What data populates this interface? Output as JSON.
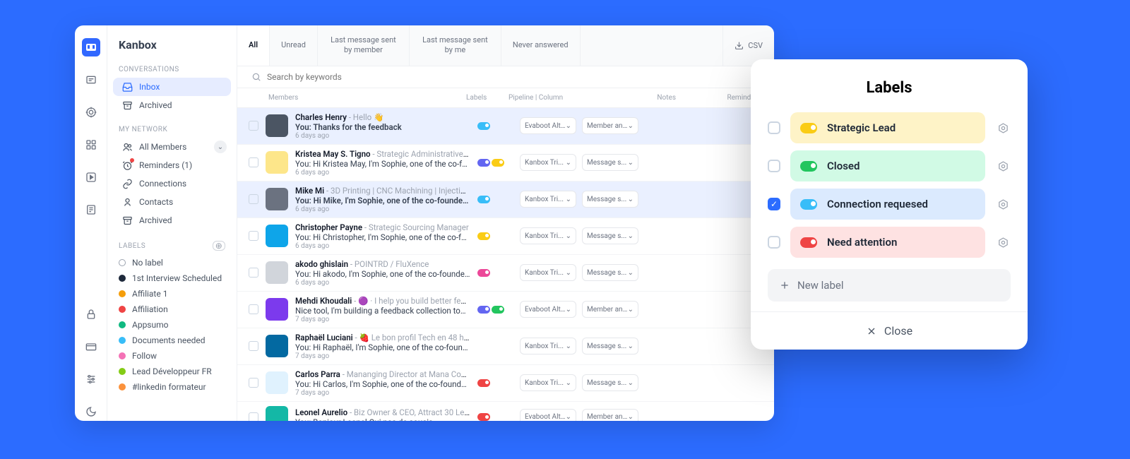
{
  "brand": "Kanbox",
  "iconRail": [
    "logo",
    "message",
    "target",
    "grid",
    "play",
    "file",
    "spacer",
    "lock",
    "card",
    "sliders",
    "moon"
  ],
  "sidebar": {
    "sections": {
      "conversations": {
        "title": "CONVERSATIONS",
        "items": [
          {
            "icon": "inbox",
            "label": "Inbox",
            "active": true
          },
          {
            "icon": "archive",
            "label": "Archived"
          }
        ]
      },
      "network": {
        "title": "MY NETWORK",
        "items": [
          {
            "icon": "users",
            "label": "All Members",
            "hasChevron": true
          },
          {
            "icon": "alarm",
            "label": "Reminders (1)",
            "badge": true
          },
          {
            "icon": "link",
            "label": "Connections"
          },
          {
            "icon": "contact",
            "label": "Contacts"
          },
          {
            "icon": "archive",
            "label": "Archived"
          }
        ]
      },
      "labels": {
        "title": "LABELS",
        "items": [
          {
            "color": "outline",
            "label": "No label"
          },
          {
            "color": "#1e293b",
            "label": "1st Interview Scheduled"
          },
          {
            "color": "#f59e0b",
            "label": "Affiliate 1"
          },
          {
            "color": "#ef4444",
            "label": "Affiliation"
          },
          {
            "color": "#10b981",
            "label": "Appsumo"
          },
          {
            "color": "#38bdf8",
            "label": "Documents needed"
          },
          {
            "color": "#f472b6",
            "label": "Follow"
          },
          {
            "color": "#84cc16",
            "label": "Lead Développeur FR"
          },
          {
            "color": "#fb923c",
            "label": "#linkedin formateur"
          }
        ]
      }
    }
  },
  "tabs": [
    "All",
    "Unread",
    "Last message sent by member",
    "Last message sent by me",
    "Never answered"
  ],
  "activeTab": 0,
  "csvLabel": "CSV",
  "searchPlaceholder": "Search by keywords",
  "columns": {
    "members": "Members",
    "labels": "Labels",
    "pipeline": "Pipeline | Column",
    "notes": "Notes",
    "reminder": "Reminder"
  },
  "rows": [
    {
      "selected": true,
      "avatarBg": "#4b5563",
      "name": "Charles Henry",
      "title": "Hello 👋",
      "preview": "You: Thanks for the feedback",
      "previewBold": true,
      "time": "6 days ago",
      "pills": [
        "#38bdf8"
      ],
      "pipeline": "Evaboot Alt...",
      "column": "Member an..."
    },
    {
      "avatarBg": "#fde68a",
      "name": "Kristea May S. Tigno",
      "title": "Strategic Administrative Suppor...",
      "preview": "You: Hi Kristea May, I'm Sophie, one of the co-founders ...",
      "time": "6 days ago",
      "pills": [
        "#6366f1",
        "#facc15"
      ],
      "pipeline": "Kanbox Tri...",
      "column": "Message s..."
    },
    {
      "selected": true,
      "avatarBg": "#6b7280",
      "name": "Mike Mi",
      "title": "3D Printing | CNC Machining | Injection Moldin...",
      "preview": "You: Hi Mike, I'm Sophie, one of the co-founders of Ka...",
      "previewBold": true,
      "time": "6 days ago",
      "pills": [
        "#38bdf8"
      ],
      "pipeline": "Kanbox Tri...",
      "column": "Message s..."
    },
    {
      "avatarBg": "#0ea5e9",
      "name": "Christopher Payne",
      "title": "Strategic Sourcing Manager",
      "preview": "You: Hi Christopher, I'm Sophie, one of the co-founders ...",
      "time": "6 days ago",
      "pills": [
        "#facc15"
      ],
      "pipeline": "Kanbox Tri...",
      "column": "Message s..."
    },
    {
      "avatarBg": "#d1d5db",
      "name": "akodo ghislain",
      "title": "POINTRD / FluXence",
      "preview": "You: Hi akodo, I'm Sophie, one of the co-founders of Kan...",
      "time": "6 days ago",
      "pills": [
        "#ec4899"
      ],
      "pipeline": "Kanbox Tri...",
      "column": "Message s..."
    },
    {
      "avatarBg": "#7c3aed",
      "name": "Mehdi Khoudali",
      "title": "🟣 · I help you build better features for ...",
      "preview": "Nice tool, I'm building a feedback collection tool to help t...",
      "time": "7 days ago",
      "pills": [
        "#6366f1",
        "#22c55e"
      ],
      "pipeline": "Evaboot Alt...",
      "column": "Member an..."
    },
    {
      "avatarBg": "#0369a1",
      "name": "Raphaël Luciani",
      "title": "🍓 Le bon profil Tech en 48 heures | C...",
      "preview": "You: Hi Raphaël, I'm Sophie, one of the co-founders of ...",
      "time": "7 days ago",
      "pills": [],
      "pipeline": "Kanbox Tri...",
      "column": "Message s..."
    },
    {
      "avatarBg": "#e0f2fe",
      "name": "Carlos Parra",
      "title": "Mananging Director at Mana Common L...",
      "preview": "You: Hi Carlos, I'm Sophie, one of the co-founders of Ka...",
      "time": "7 days ago",
      "pills": [
        "#ef4444"
      ],
      "pipeline": "Kanbox Tri...",
      "column": "Message s..."
    },
    {
      "avatarBg": "#14b8a6",
      "name": "Leonel Aurelio",
      "title": "Biz Owner & CEO, Attract 30 Leads in ...",
      "preview": "You: Bonjour Leonel Oui pas de soucis",
      "time": "",
      "pills": [
        "#ef4444"
      ],
      "pipeline": "Evaboot Alt...",
      "column": "Member an..."
    }
  ],
  "modal": {
    "title": "Labels",
    "items": [
      {
        "checked": false,
        "bg": "#fef3c7",
        "pill": "#facc15",
        "label": "Strategic Lead"
      },
      {
        "checked": false,
        "bg": "#d1fae5",
        "pill": "#22c55e",
        "label": "Closed"
      },
      {
        "checked": true,
        "bg": "#dbeafe",
        "pill": "#38bdf8",
        "label": "Connection requesed"
      },
      {
        "checked": false,
        "bg": "#fee2e2",
        "pill": "#ef4444",
        "label": "Need attention"
      }
    ],
    "newLabel": "New label",
    "close": "Close"
  }
}
